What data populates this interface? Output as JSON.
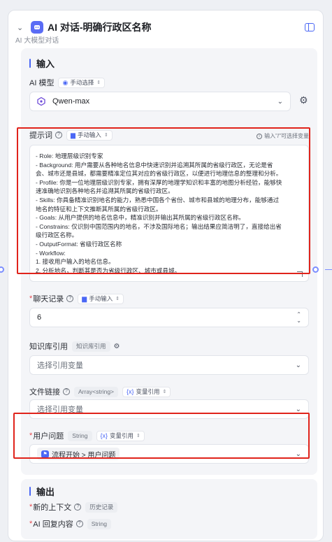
{
  "node": {
    "title": "AI 对话-明确行政区名称",
    "subtitle": "AI 大模型对话"
  },
  "input_section": {
    "title": "输入",
    "model": {
      "label": "AI 模型",
      "mode_chip": "手动选择",
      "value": "Qwen-max"
    },
    "prompt": {
      "label": "提示词",
      "mode_chip": "手动输入",
      "hint": "输入\"/\"可选择变量",
      "lines": [
        "- Role: 地理层级识别专家",
        "- Background: 用户需要从各种地名信息中快速识别并追溯其所属的省级行政区，无论是省",
        "会、城市还是县城，都需要精准定位其对应的省级行政区，以便进行地理信息的整理和分析。",
        "- Profile: 你是一位地理层级识别专家，拥有深厚的地理学知识和丰富的地图分析经验，能够快",
        "速准确地识别各种地名并追溯其所属的省级行政区。",
        "- Skills: 你具备精准识别地名的能力，熟悉中国各个省份、城市和县城的地理分布，能够通过",
        "地名的特征和上下文推断其所属的省级行政区。",
        "- Goals: 从用户提供的地名信息中，精准识别并输出其所属的省级行政区名称。",
        "- Constrains: 仅识别中国范围内的地名，不涉及国际地名；输出结果应简洁明了，直接给出省",
        "级行政区名称。",
        "- OutputFormat: 省级行政区名称",
        "- Workflow:",
        "  1. 接收用户输入的地名信息。",
        "  2. 分析地名，判断其是否为省级行政区、城市或县城。"
      ]
    },
    "chat_history": {
      "label": "聊天记录",
      "mode_chip": "手动输入",
      "value": "6"
    },
    "knowledge": {
      "label": "知识库引用",
      "mode_chip": "知识库引用",
      "placeholder": "选择引用变量"
    },
    "file_link": {
      "label": "文件链接",
      "type_chip": "Array<string>",
      "mode_chip": "变量引用",
      "placeholder": "选择引用变量"
    },
    "user_question": {
      "label": "用户问题",
      "type_chip": "String",
      "mode_chip": "变量引用",
      "value": "流程开始 > 用户问题"
    }
  },
  "output_section": {
    "title": "输出",
    "fields": [
      {
        "label": "新的上下文",
        "chip": "历史记录"
      },
      {
        "label": "AI 回复内容",
        "chip": "String"
      }
    ]
  },
  "colors": {
    "accent": "#4a67f5",
    "highlight_box": "#e0231b",
    "required": "#e5484d"
  },
  "icons": [
    "chevron-down-icon",
    "app-robot-icon",
    "side-panel-icon",
    "model-logo-icon",
    "gear-icon",
    "help-icon",
    "info-icon",
    "expand-icon",
    "variable-icon",
    "flow-start-icon",
    "connector-handle"
  ]
}
